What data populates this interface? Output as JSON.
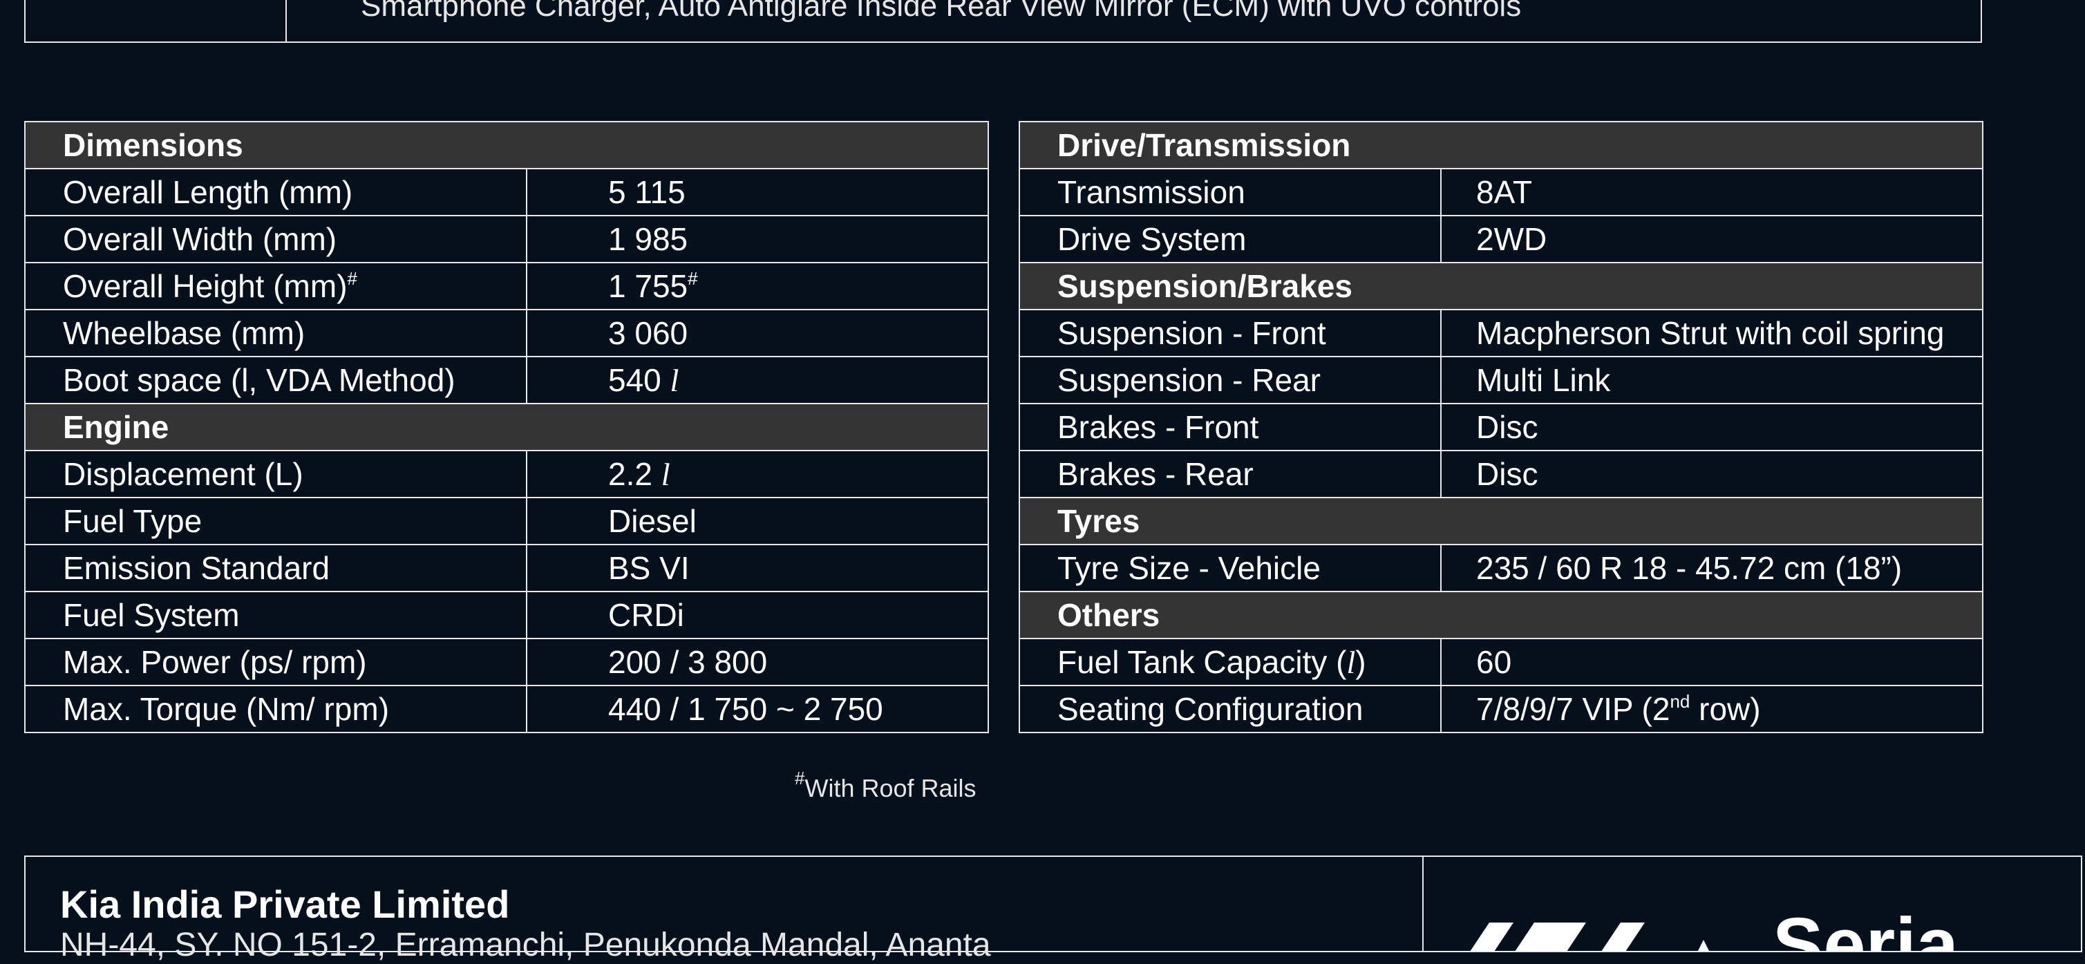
{
  "top_box": {
    "text": "Smartphone Charger, Auto Antiglare Inside Rear View Mirror (ECM) with UVO controls"
  },
  "left_table": {
    "dimensions_title": "Dimensions",
    "overall_length_label": "Overall Length (mm)",
    "overall_length_value": "5 115",
    "overall_width_label": "Overall Width (mm)",
    "overall_width_value": "1 985",
    "overall_height_label": "Overall Height (mm)",
    "overall_height_value": "1 755",
    "hash_mark": "#",
    "wheelbase_label": "Wheelbase (mm)",
    "wheelbase_value": "3 060",
    "boot_label": "Boot space (l, VDA Method)",
    "boot_value": "540",
    "litre_symbol": "l",
    "engine_title": "Engine",
    "displacement_label": "Displacement (L)",
    "displacement_value": "2.2",
    "fuel_type_label": "Fuel Type",
    "fuel_type_value": "Diesel",
    "emission_label": "Emission Standard",
    "emission_value": "BS VI",
    "fuel_system_label": "Fuel System",
    "fuel_system_value": "CRDi",
    "power_label": "Max. Power (ps/ rpm)",
    "power_value": "200 / 3 800",
    "torque_label": "Max. Torque (Nm/ rpm)",
    "torque_value": "440 / 1 750 ~ 2 750"
  },
  "right_table": {
    "drive_title": "Drive/Transmission",
    "transmission_label": "Transmission",
    "transmission_value": "8AT",
    "drive_system_label": "Drive System",
    "drive_system_value": "2WD",
    "suspension_title": "Suspension/Brakes",
    "susp_front_label": "Suspension - Front",
    "susp_front_value": "Macpherson Strut with coil spring",
    "susp_rear_label": "Suspension - Rear",
    "susp_rear_value": "Multi Link",
    "brakes_front_label": "Brakes - Front",
    "brakes_front_value": "Disc",
    "brakes_rear_label": "Brakes - Rear",
    "brakes_rear_value": "Disc",
    "tyres_title": "Tyres",
    "tyre_size_label": "Tyre Size - Vehicle",
    "tyre_size_value": "235 / 60 R 18 - 45.72 cm (18”)",
    "others_title": "Others",
    "fuel_tank_label_pre": "Fuel Tank Capacity (",
    "fuel_tank_label_post": ")",
    "fuel_tank_value": "60",
    "seating_label": "Seating Configuration",
    "seating_value_pre": "7/8/9/7 VIP (2",
    "seating_value_sup": "nd",
    "seating_value_post": " row)"
  },
  "footnote": {
    "mark": "#",
    "text": "With Roof Rails"
  },
  "bottom": {
    "company": "Kia India Private Limited",
    "address": "NH-44, SY. NO 151-2, Erramanchi, Penukonda Mandal, Ananta"
  },
  "logo": {
    "text": "KIA  Seria",
    "icon": "kia-logo"
  },
  "colors": {
    "background": "#06101c",
    "section_header": "#343434",
    "border": "#e8e8e8",
    "text": "#ffffff"
  }
}
